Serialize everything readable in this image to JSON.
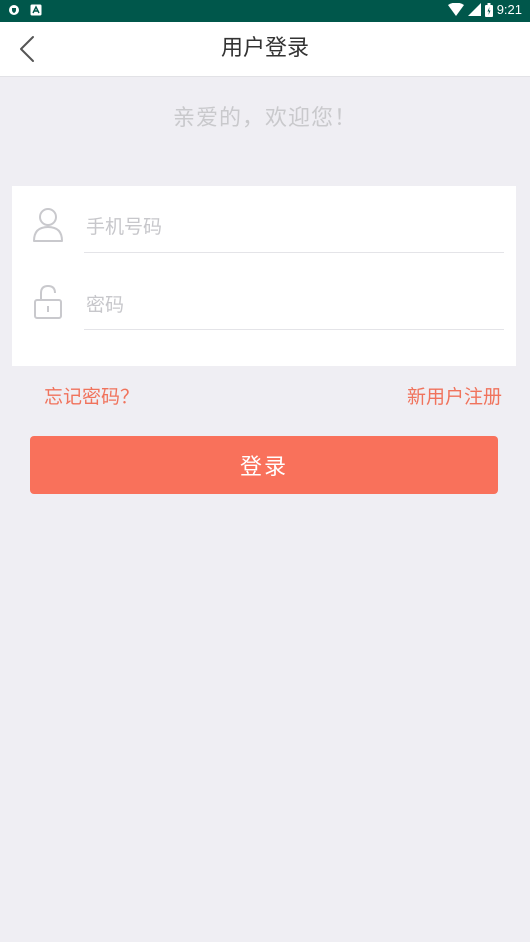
{
  "status_bar": {
    "time": "9:21",
    "icons": [
      "shield-icon",
      "notification-a-icon",
      "wifi-icon",
      "signal-icon",
      "battery-icon"
    ]
  },
  "app_bar": {
    "title": "用户登录",
    "back_icon": "chevron-left-icon"
  },
  "welcome_text": "亲爱的，欢迎您！",
  "form": {
    "phone_placeholder": "手机号码",
    "phone_value": "",
    "phone_icon": "user-icon",
    "password_placeholder": "密码",
    "password_value": "",
    "password_icon": "unlock-icon"
  },
  "links": {
    "forgot_password": "忘记密码？",
    "register": "新用户注册"
  },
  "login_button": "登录",
  "colors": {
    "status_bar": "#00574b",
    "accent": "#f9715b",
    "background": "#efeef3"
  }
}
